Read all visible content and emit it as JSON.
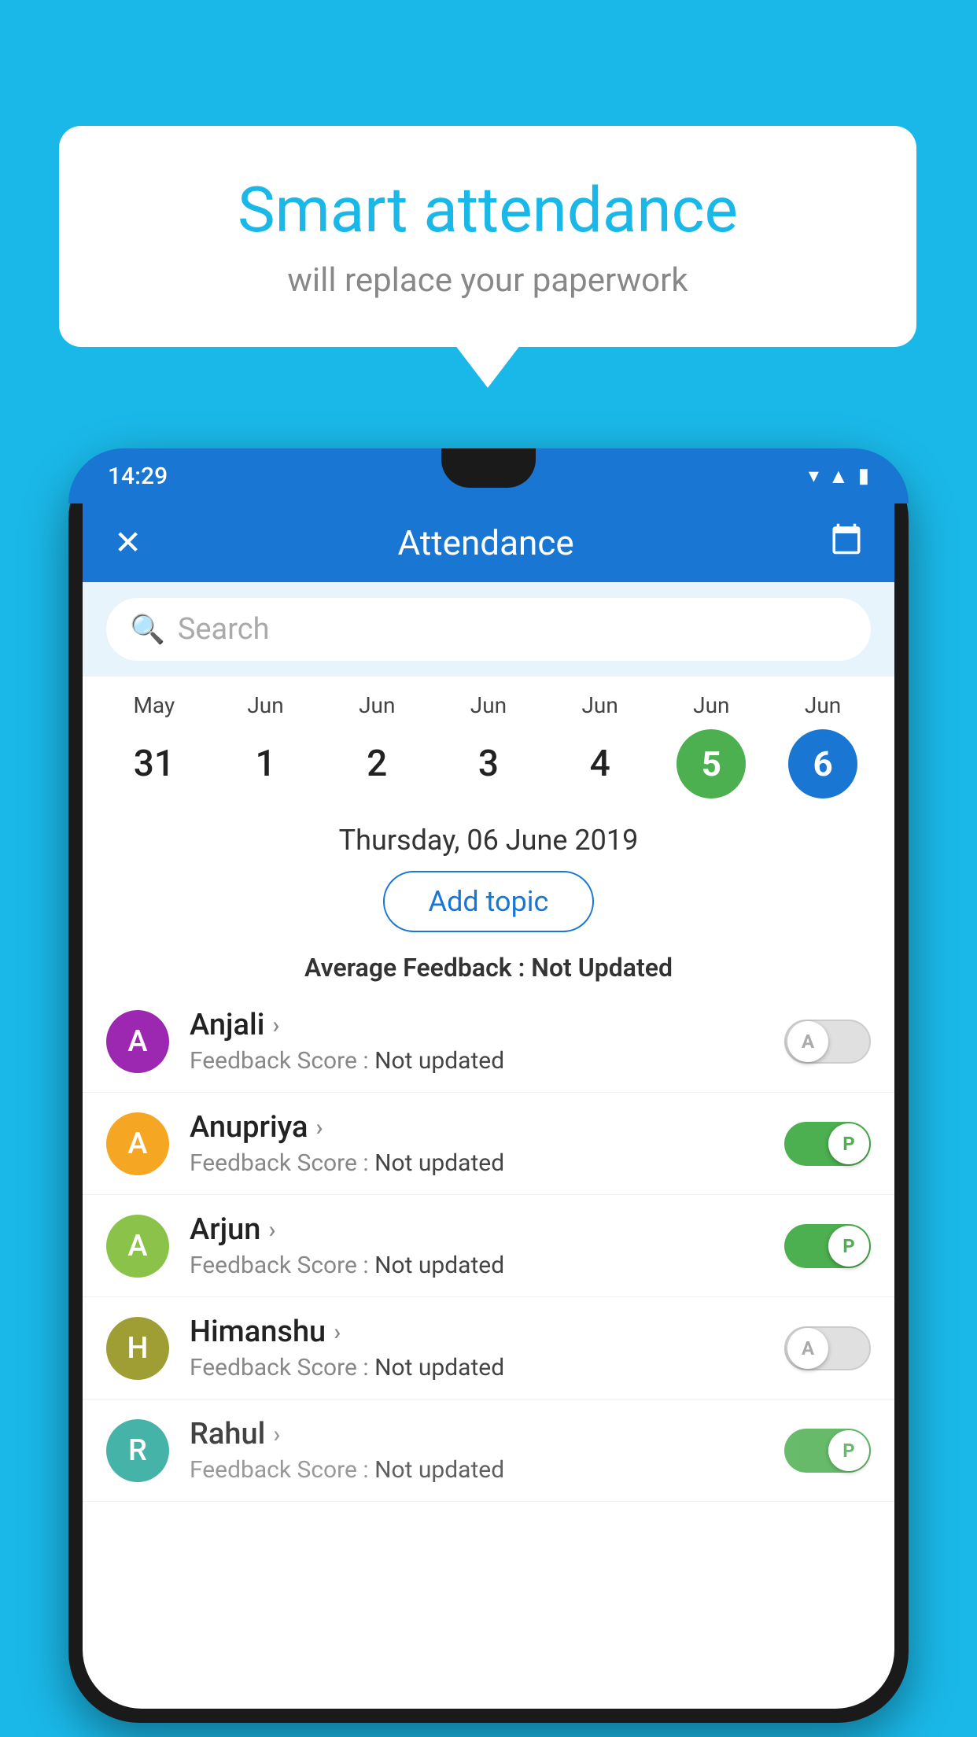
{
  "background_color": "#1ab8e8",
  "bubble": {
    "title": "Smart attendance",
    "subtitle": "will replace your paperwork"
  },
  "status_bar": {
    "time": "14:29",
    "icons": [
      "wifi",
      "signal",
      "battery"
    ]
  },
  "header": {
    "title": "Attendance",
    "close_label": "✕",
    "calendar_icon": "📅"
  },
  "search": {
    "placeholder": "Search"
  },
  "calendar": {
    "columns": [
      {
        "month": "May",
        "date": "31",
        "type": "normal"
      },
      {
        "month": "Jun",
        "date": "1",
        "type": "normal"
      },
      {
        "month": "Jun",
        "date": "2",
        "type": "normal"
      },
      {
        "month": "Jun",
        "date": "3",
        "type": "normal"
      },
      {
        "month": "Jun",
        "date": "4",
        "type": "normal"
      },
      {
        "month": "Jun",
        "date": "5",
        "type": "green"
      },
      {
        "month": "Jun",
        "date": "6",
        "type": "blue"
      }
    ]
  },
  "selected_date": {
    "full_date": "Thursday, 06 June 2019",
    "add_topic_label": "Add topic",
    "feedback_label": "Average Feedback :",
    "feedback_value": "Not Updated"
  },
  "students": [
    {
      "name": "Anjali",
      "avatar_letter": "A",
      "avatar_color": "purple",
      "feedback_label": "Feedback Score :",
      "feedback_value": "Not updated",
      "toggle": "off",
      "toggle_letter": "A"
    },
    {
      "name": "Anupriya",
      "avatar_letter": "A",
      "avatar_color": "yellow",
      "feedback_label": "Feedback Score :",
      "feedback_value": "Not updated",
      "toggle": "on",
      "toggle_letter": "P"
    },
    {
      "name": "Arjun",
      "avatar_letter": "A",
      "avatar_color": "green-light",
      "feedback_label": "Feedback Score :",
      "feedback_value": "Not updated",
      "toggle": "on",
      "toggle_letter": "P"
    },
    {
      "name": "Himanshu",
      "avatar_letter": "H",
      "avatar_color": "olive",
      "feedback_label": "Feedback Score :",
      "feedback_value": "Not updated",
      "toggle": "off",
      "toggle_letter": "A"
    },
    {
      "name": "Rahul",
      "avatar_letter": "R",
      "avatar_color": "teal",
      "feedback_label": "Feedback Score :",
      "feedback_value": "Not updated",
      "toggle": "on",
      "toggle_letter": "P"
    }
  ]
}
